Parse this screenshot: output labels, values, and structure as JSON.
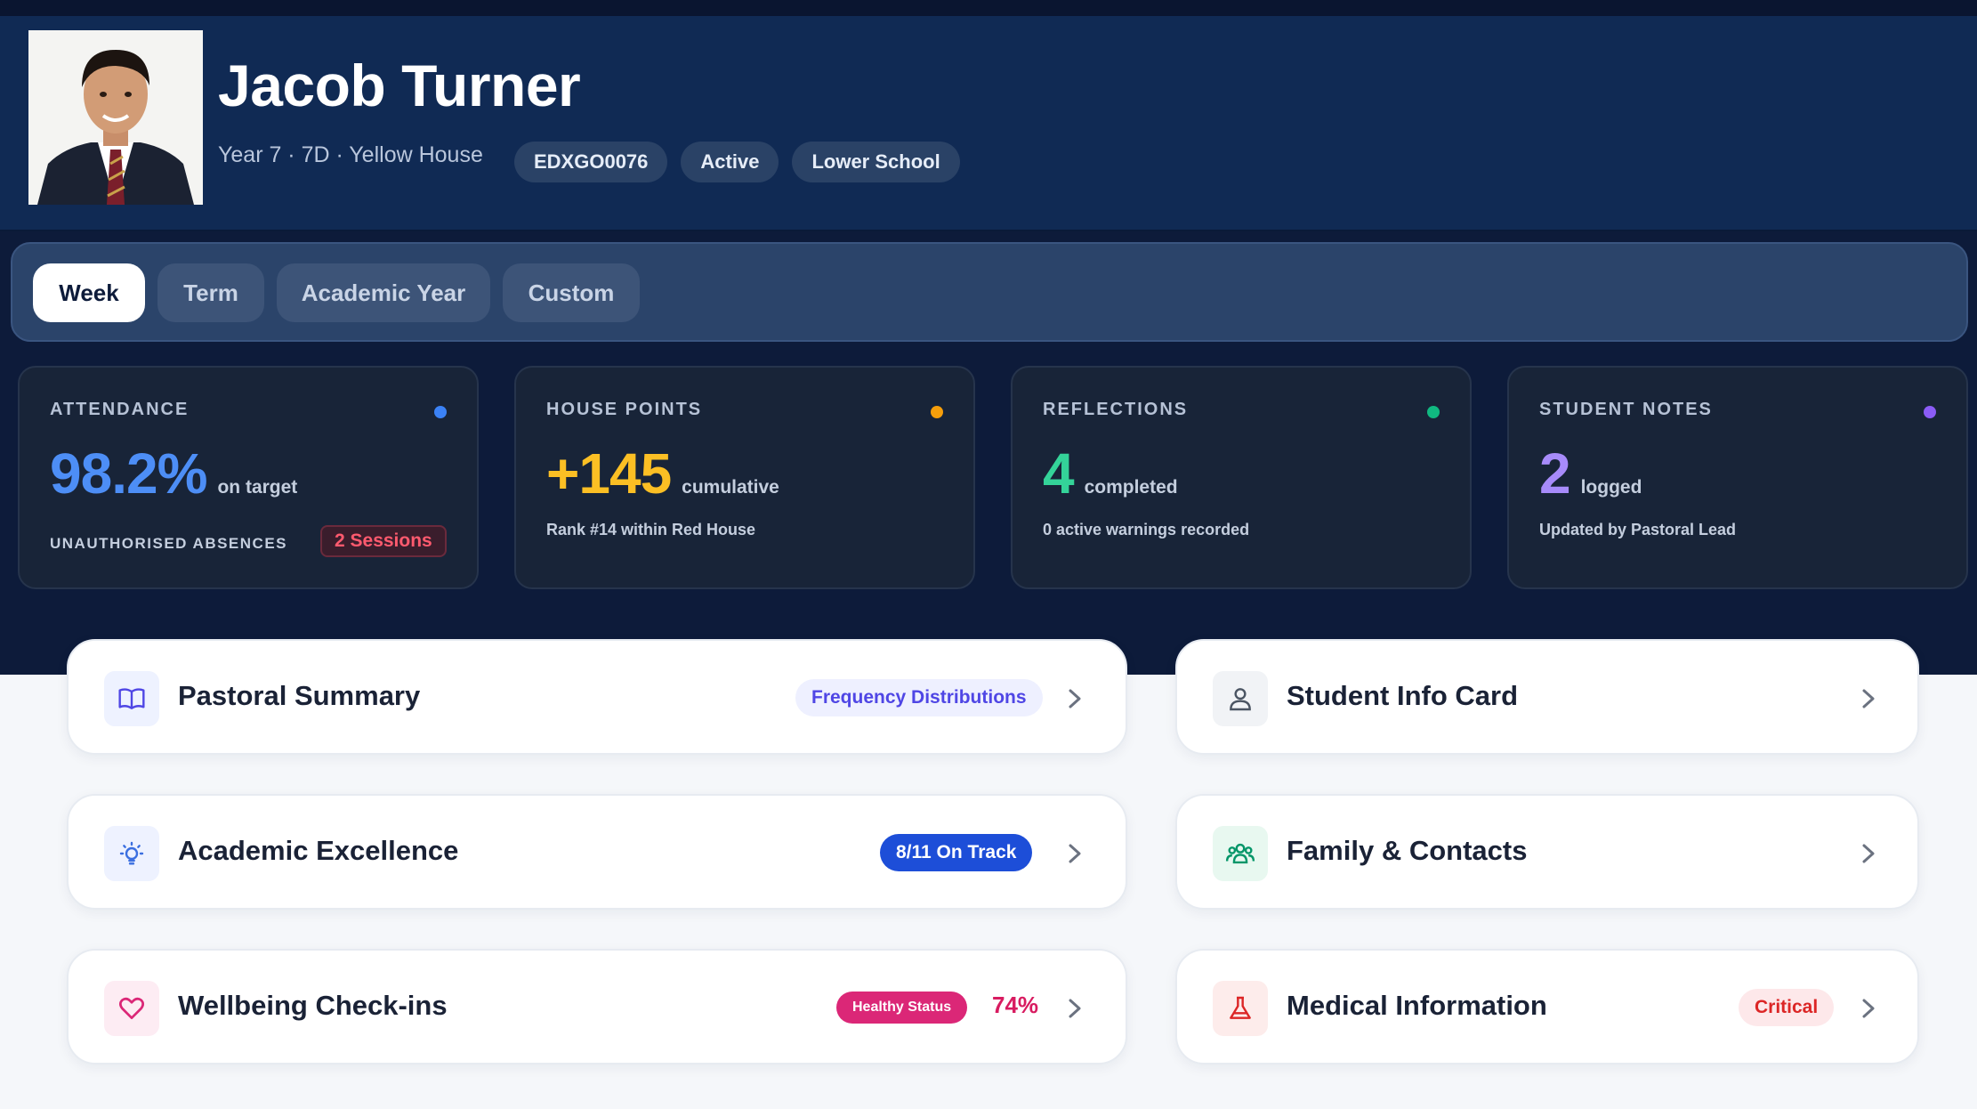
{
  "student": {
    "name": "Jacob Turner",
    "subline": "Year 7 · 7D · Yellow House",
    "chips": [
      "EDXGO0076",
      "Active",
      "Lower School"
    ]
  },
  "tabs": [
    {
      "label": "Week",
      "active": true
    },
    {
      "label": "Term",
      "active": false
    },
    {
      "label": "Academic Year",
      "active": false
    },
    {
      "label": "Custom",
      "active": false
    }
  ],
  "stats": [
    {
      "label": "ATTENDANCE",
      "value": "98.2%",
      "suffix": "on target",
      "sub": "UNAUTHORISED ABSENCES",
      "badge": "2 Sessions",
      "color": "#4d8ef6",
      "dot": "#3b82f6"
    },
    {
      "label": "HOUSE POINTS",
      "value": "+145",
      "suffix": "cumulative",
      "sub": "Rank #14 within Red House",
      "color": "#fbbf24",
      "dot": "#f59e0b"
    },
    {
      "label": "REFLECTIONS",
      "value": "4",
      "suffix": "completed",
      "sub": "0 active warnings recorded",
      "color": "#34d399",
      "dot": "#10b981"
    },
    {
      "label": "STUDENT NOTES",
      "value": "2",
      "suffix": "logged",
      "sub": "Updated by Pastoral Lead",
      "color": "#a78bfa",
      "dot": "#8b5cf6"
    }
  ],
  "cards": {
    "pastoral": {
      "title": "Pastoral Summary",
      "badge": "Frequency Distributions",
      "icon": "book-icon"
    },
    "academic": {
      "title": "Academic Excellence",
      "badge": "8/11 On Track",
      "icon": "lightbulb-icon"
    },
    "wellbeing": {
      "title": "Wellbeing Check-ins",
      "badge": "Healthy Status",
      "percent": "74%",
      "icon": "heart-icon"
    },
    "info": {
      "title": "Student Info Card",
      "icon": "user-icon"
    },
    "family": {
      "title": "Family & Contacts",
      "icon": "users-icon"
    },
    "medical": {
      "title": "Medical Information",
      "badge": "Critical",
      "icon": "flask-icon"
    }
  }
}
